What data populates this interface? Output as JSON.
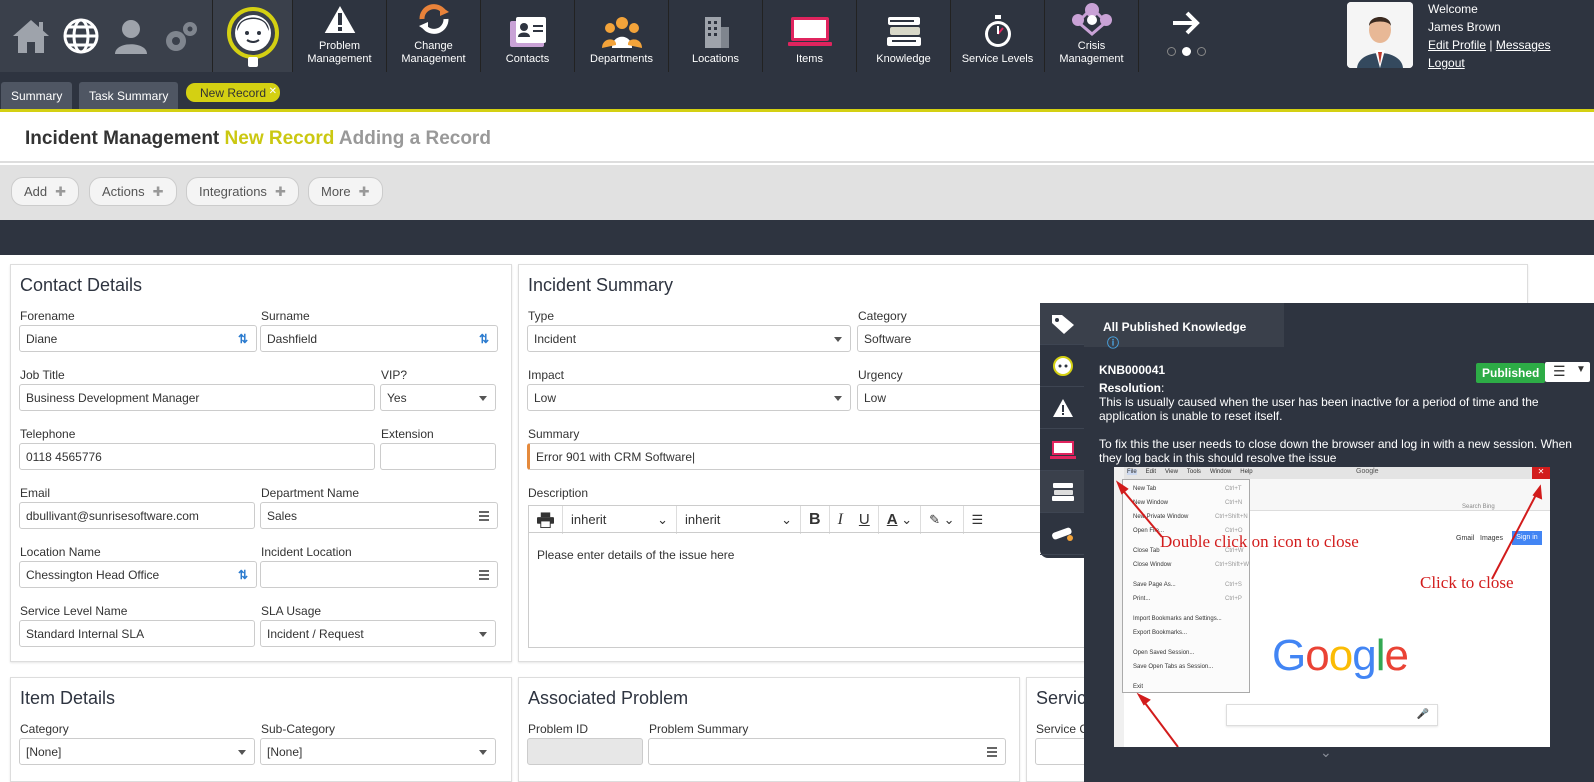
{
  "nav": {
    "quick": [
      {
        "name": "home-icon"
      },
      {
        "name": "globe-icon"
      },
      {
        "name": "user-icon"
      },
      {
        "name": "settings-gears-icon"
      }
    ],
    "logo": "headset-agent-logo",
    "items": [
      {
        "label": "Problem\nManagement",
        "icon": "warning-triangle-icon"
      },
      {
        "label": "Change\nManagement",
        "icon": "refresh-arrows-icon"
      },
      {
        "label": "Contacts",
        "icon": "contact-card-icon"
      },
      {
        "label": "Departments",
        "icon": "people-group-icon"
      },
      {
        "label": "Locations",
        "icon": "building-icon"
      },
      {
        "label": "Items",
        "icon": "monitor-icon"
      },
      {
        "label": "Knowledge",
        "icon": "books-icon"
      },
      {
        "label": "Service Levels",
        "icon": "stopwatch-icon"
      },
      {
        "label": "Crisis\nManagement",
        "icon": "crisis-network-icon"
      }
    ]
  },
  "user": {
    "welcome": "Welcome",
    "name": "James Brown",
    "edit_profile": "Edit Profile",
    "separator": "|",
    "messages": "Messages",
    "logout": "Logout"
  },
  "tabs": [
    {
      "label": "Summary"
    },
    {
      "label": "Task Summary"
    },
    {
      "label": "New Record"
    }
  ],
  "page": {
    "title": "Incident Management",
    "record": "New Record",
    "mode": "Adding a Record"
  },
  "actions": [
    {
      "label": "Add"
    },
    {
      "label": "Actions"
    },
    {
      "label": "Integrations"
    },
    {
      "label": "More"
    }
  ],
  "contact": {
    "title": "Contact Details",
    "forename_label": "Forename",
    "forename": "Diane",
    "surname_label": "Surname",
    "surname": "Dashfield",
    "job_label": "Job Title",
    "job": "Business Development Manager",
    "vip_label": "VIP?",
    "vip": "Yes",
    "tel_label": "Telephone",
    "tel": "0118 4565776",
    "ext_label": "Extension",
    "ext": "",
    "email_label": "Email",
    "email": "dbullivant@sunrisesoftware.com",
    "dept_label": "Department Name",
    "dept": "Sales",
    "loc_label": "Location Name",
    "loc": "Chessington Head Office",
    "incloc_label": "Incident Location",
    "incloc": "",
    "sl_label": "Service Level Name",
    "sl": "Standard Internal SLA",
    "sla_label": "SLA Usage",
    "sla": "Incident / Request"
  },
  "incident": {
    "title": "Incident Summary",
    "type_label": "Type",
    "type": "Incident",
    "cat_label": "Category",
    "cat": "Software",
    "impact_label": "Impact",
    "impact": "Low",
    "urgency_label": "Urgency",
    "urgency": "Low",
    "summary_label": "Summary",
    "summary": "Error 901 with CRM Software",
    "desc_label": "Description",
    "font1": "inherit",
    "font2": "inherit",
    "desc_placeholder": "Please enter details of the issue here"
  },
  "item": {
    "title": "Item Details",
    "cat_label": "Category",
    "cat": "[None]",
    "subcat_label": "Sub-Category",
    "subcat": "[None]"
  },
  "problem": {
    "title": "Associated Problem",
    "id_label": "Problem ID",
    "summary_label": "Problem Summary"
  },
  "service": {
    "title": "Servic",
    "label": "Service C"
  },
  "knowledge": {
    "header": "All Published Knowledge",
    "id": "KNB000041",
    "status": "Published",
    "status_color": "#2dac46",
    "resolution_label": "Resolution",
    "resolution_colon": ":",
    "line1": "This is usually caused when the user has been inactive for a period of time and the application is unable to reset itself.",
    "line2": "To fix this the user needs to close down the browser and log in with a new session. When they log back in this should resolve the issue",
    "side_icons": [
      "tag-icon",
      "headset-icon",
      "warning-icon",
      "monitor-icon",
      "books-icon",
      "diploma-icon"
    ],
    "screenshot": {
      "menus": [
        "File",
        "Edit",
        "View",
        "Tools",
        "Window",
        "Help"
      ],
      "window_title": "Google",
      "file_menu": [
        {
          "label": "New Tab",
          "key": "Ctrl+T"
        },
        {
          "label": "New Window",
          "key": "Ctrl+N"
        },
        {
          "label": "New Private Window",
          "key": "Ctrl+Shift+N"
        },
        {
          "label": "Open File...",
          "key": "Ctrl+O"
        },
        {
          "label": "Close Tab",
          "key": "Ctrl+W"
        },
        {
          "label": "Close Window",
          "key": "Ctrl+Shift+W"
        },
        {
          "label": "Save Page As...",
          "key": "Ctrl+S"
        },
        {
          "label": "Print...",
          "key": "Ctrl+P"
        },
        {
          "label": "Import Bookmarks and Settings...",
          "key": ""
        },
        {
          "label": "Export Bookmarks...",
          "key": ""
        },
        {
          "label": "Open Saved Session...",
          "key": ""
        },
        {
          "label": "Save Open Tabs as Session...",
          "key": ""
        },
        {
          "label": "Exit",
          "key": ""
        }
      ],
      "search_placeholder": "Search Bing",
      "gmail": "Gmail",
      "images": "Images",
      "sign_in": "Sign in",
      "google": "Google",
      "annotation_left": "Double click on icon to close",
      "annotation_right": "Click to close"
    }
  }
}
